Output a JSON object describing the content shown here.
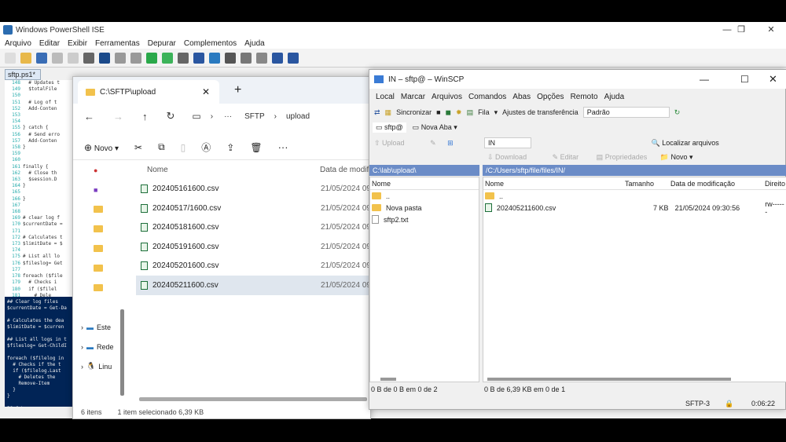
{
  "ise": {
    "title": "Windows PowerShell ISE",
    "menu": [
      "Arquivo",
      "Editar",
      "Exibir",
      "Ferramentas",
      "Depurar",
      "Complementos",
      "Ajuda"
    ],
    "tab": "sftp.ps1*",
    "code": [
      [
        "148",
        "  # Updates t"
      ],
      [
        "149",
        "  $totalFile"
      ],
      [
        "150",
        ""
      ],
      [
        "151",
        "  # Log of t"
      ],
      [
        "152",
        "  Add-Conten"
      ],
      [
        "153",
        ""
      ],
      [
        "154",
        ""
      ],
      [
        "155",
        "} catch {"
      ],
      [
        "156",
        "  # Send erro"
      ],
      [
        "157",
        "  Add-Conten"
      ],
      [
        "158",
        "}"
      ],
      [
        "159",
        ""
      ],
      [
        "160",
        ""
      ],
      [
        "161",
        "finally {"
      ],
      [
        "162",
        "  # Close th"
      ],
      [
        "163",
        "  $session.D"
      ],
      [
        "164",
        "}"
      ],
      [
        "165",
        ""
      ],
      [
        "166",
        "}"
      ],
      [
        "167",
        ""
      ],
      [
        "168",
        ""
      ],
      [
        "169",
        "# clear log f"
      ],
      [
        "170",
        "$currentDate ="
      ],
      [
        "171",
        ""
      ],
      [
        "172",
        "# Calculates t"
      ],
      [
        "173",
        "$limitDate = $"
      ],
      [
        "174",
        ""
      ],
      [
        "175",
        "# List all lo"
      ],
      [
        "176",
        "$fileslog= Get"
      ],
      [
        "177",
        ""
      ],
      [
        "178",
        "foreach ($file"
      ],
      [
        "179",
        "  # Checks i"
      ],
      [
        "180",
        "  if ($filel"
      ],
      [
        "181",
        "    # Dele"
      ],
      [
        "182",
        "    Remove"
      ],
      [
        "183",
        "  }"
      ],
      [
        "184",
        "}"
      ]
    ],
    "console": "## Clear log files\n$currentDate = Get-Da\n\n# Calculates the dea\n$limitDate = $curren\n\n## List all logs in t\n$fileslog= Get-ChildI\n\nforeach ($filelog in\n  # Checks if the t\n  if ($filelog.Last\n    # Deletes the\n    Remove-Item\n  }\n}\n\nPS C:\\>"
  },
  "explorer": {
    "tab_title": "C:\\SFTP\\upload",
    "path": [
      "SFTP",
      "upload"
    ],
    "new_label": "Novo",
    "columns": [
      "Nome",
      "Data de modifi"
    ],
    "files": [
      {
        "name": "202405161600.csv",
        "date": "21/05/2024 09"
      },
      {
        "name": "20240517/1600.csv",
        "date": "21/05/2024 09"
      },
      {
        "name": "202405181600.csv",
        "date": "21/05/2024 09"
      },
      {
        "name": "202405191600.csv",
        "date": "21/05/2024 09"
      },
      {
        "name": "202405201600.csv",
        "date": "21/05/2024 09"
      },
      {
        "name": "202405211600.csv",
        "date": "21/05/2024 09"
      }
    ],
    "side": [
      "Este",
      "Rede",
      "Linu"
    ],
    "status_count": "6 itens",
    "status_sel": "1 item selecionado  6,39 KB"
  },
  "winscp": {
    "title": "IN – sftp@ – WinSCP",
    "menu": [
      "Local",
      "Marcar",
      "Arquivos",
      "Comandos",
      "Abas",
      "Opções",
      "Remoto",
      "Ajuda"
    ],
    "sync": "Sincronizar",
    "queue": "Fila",
    "transfer": "Ajustes de transferência",
    "transfer_val": "Padrão",
    "session_tab": "sftp@",
    "new_tab": "Nova Aba",
    "remote_dir": "IN",
    "find": "Localizar arquivos",
    "upload": "Upload",
    "edit": "Editar",
    "download": "Download",
    "props": "Propriedades",
    "new": "Novo",
    "left_path": "C:\\lab\\upload\\",
    "right_path": "/C:/Users/sftp/file/files/IN/",
    "left_hdr": "Nome",
    "left_items": [
      "..",
      "Nova pasta",
      "sftp2.txt"
    ],
    "right_hdr": [
      "Nome",
      "Tamanho",
      "Data de modificação",
      "Direito"
    ],
    "right_items": [
      {
        "name": "..",
        "size": "",
        "date": "",
        "rights": ""
      },
      {
        "name": "202405211600.csv",
        "size": "7 KB",
        "date": "21/05/2024 09:30:56",
        "rights": "rw------"
      }
    ],
    "left_status": "0 B de 0 B em 0 de 2",
    "right_status": "0 B de 6,39 KB em 0 de 1",
    "proto": "SFTP-3",
    "time": "0:06:22"
  }
}
